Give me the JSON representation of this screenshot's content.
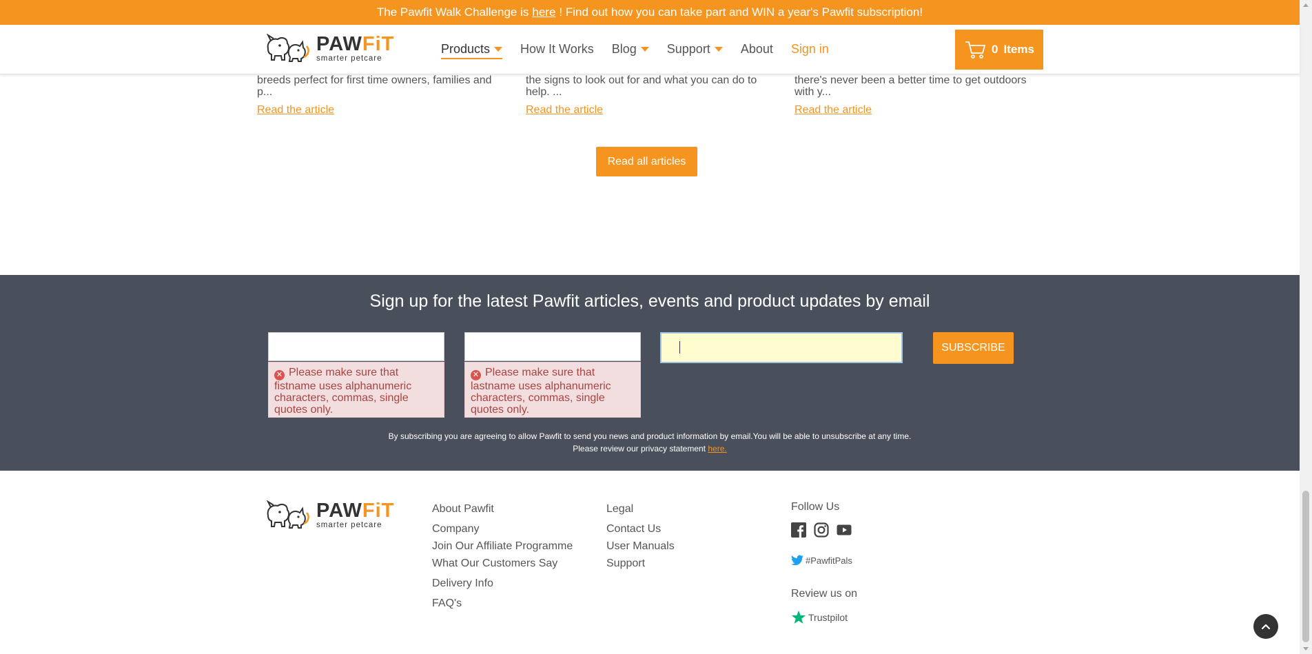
{
  "announcement": {
    "prefix": "The Pawfit Walk Challenge is",
    "link": "here",
    "suffix": "! Find out how you can take part and WIN a year's Pawfit subscription!"
  },
  "logo": {
    "brand_paw": "PAW",
    "brand_fit": "FiT",
    "tagline": "smarter petcare"
  },
  "nav": {
    "products": "Products",
    "how_it_works": "How It Works",
    "blog": "Blog",
    "support": "Support",
    "about": "About",
    "sign_in": "Sign in"
  },
  "cart": {
    "count": "0",
    "label": "Items"
  },
  "articles": [
    {
      "snippet": "breeds perfect for first time owners, families and p...",
      "link": "Read the article"
    },
    {
      "snippet": "the signs to look out for and what you can do to help. ...",
      "link": "Read the article"
    },
    {
      "snippet": "there's never been a better time to get outdoors with y...",
      "link": "Read the article"
    }
  ],
  "read_all": "Read all articles",
  "newsletter": {
    "title": "Sign up for the latest Pawfit articles, events and product updates by email",
    "firstname_value": "",
    "lastname_value": "",
    "email_value": "",
    "firstname_error": "Please make sure that fistname uses alphanumeric characters, commas, single quotes only.",
    "lastname_error": "Please make sure that lastname uses alphanumeric characters, commas, single quotes only.",
    "subscribe": "SUBSCRIBE",
    "note_line1": "By subscribing you are agreeing to allow Pawfit to send you news and product information by email.You will be able to unsubscribe at any time.",
    "note_line2": "Please review our privacy statement",
    "note_link": "here."
  },
  "footer": {
    "col1": [
      "About Pawfit",
      "Company",
      "Join Our Affiliate Programme",
      "What Our Customers Say",
      "Delivery Info",
      "FAQ's"
    ],
    "col2": [
      "Legal",
      "Contact Us",
      "User Manuals",
      "Support"
    ],
    "follow_us": "Follow Us",
    "hashtag": "#PawfitPals",
    "review_us": "Review us on",
    "trustpilot": "Trustpilot"
  },
  "colors": {
    "accent": "#f5941e",
    "dark_band": "#4a4f5c",
    "error_bg": "#f2dede",
    "error_text": "#a94442"
  }
}
